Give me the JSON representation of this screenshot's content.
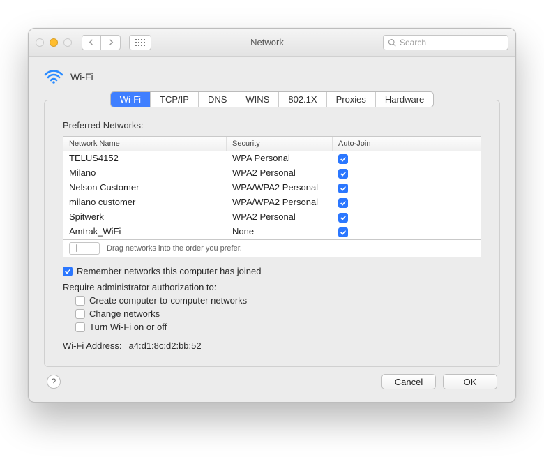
{
  "titlebar": {
    "title": "Network",
    "search_placeholder": "Search"
  },
  "page_heading": "Wi-Fi",
  "tabs": [
    "Wi-Fi",
    "TCP/IP",
    "DNS",
    "WINS",
    "802.1X",
    "Proxies",
    "Hardware"
  ],
  "active_tab_index": 0,
  "preferred_networks": {
    "label": "Preferred Networks:",
    "columns": {
      "name": "Network Name",
      "security": "Security",
      "autojoin": "Auto-Join"
    },
    "rows": [
      {
        "name": "TELUS4152",
        "security": "WPA Personal",
        "autojoin": true
      },
      {
        "name": "Milano",
        "security": "WPA2 Personal",
        "autojoin": true
      },
      {
        "name": "Nelson Customer",
        "security": "WPA/WPA2 Personal",
        "autojoin": true
      },
      {
        "name": "milano customer",
        "security": "WPA/WPA2 Personal",
        "autojoin": true
      },
      {
        "name": "Spitwerk",
        "security": "WPA2 Personal",
        "autojoin": true
      },
      {
        "name": "Amtrak_WiFi",
        "security": "None",
        "autojoin": true
      }
    ],
    "drag_hint": "Drag networks into the order you prefer."
  },
  "remember": {
    "checked": true,
    "label": "Remember networks this computer has joined"
  },
  "admin_section": {
    "label": "Require administrator authorization to:",
    "options": [
      {
        "label": "Create computer-to-computer networks",
        "checked": false
      },
      {
        "label": "Change networks",
        "checked": false
      },
      {
        "label": "Turn Wi-Fi on or off",
        "checked": false
      }
    ]
  },
  "wifi_address": {
    "label": "Wi-Fi Address:",
    "value": "a4:d1:8c:d2:bb:52"
  },
  "buttons": {
    "cancel": "Cancel",
    "ok": "OK"
  }
}
